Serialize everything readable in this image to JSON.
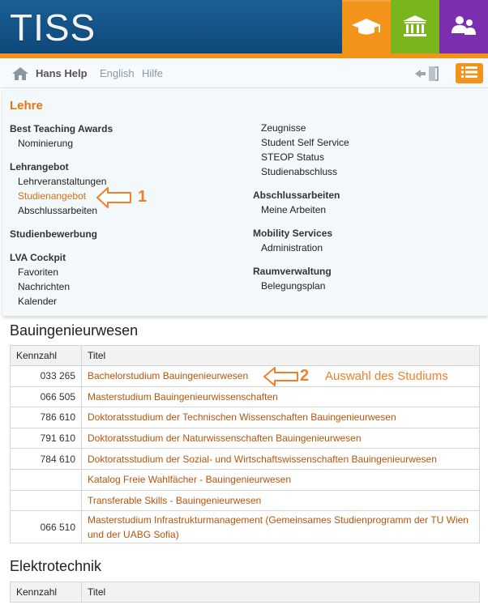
{
  "header": {
    "logo": "TISS",
    "tabs": [
      {
        "icon": "graduation-cap-icon",
        "color": "#f29419"
      },
      {
        "icon": "institution-icon",
        "color": "#7ab51d"
      },
      {
        "icon": "people-icon",
        "color": "#7b2fae"
      }
    ]
  },
  "toolbar": {
    "user": "Hans Help",
    "language": "English",
    "help": "Hilfe"
  },
  "menu": {
    "title": "Lehre",
    "left_groups": [
      {
        "heading": "Best Teaching Awards",
        "items": [
          "Nominierung"
        ]
      },
      {
        "heading": "Lehrangebot",
        "items": [
          "Lehrveranstaltungen",
          "Studienangebot",
          "Abschlussarbeiten"
        ]
      },
      {
        "heading": "Studienbewerbung",
        "items": []
      },
      {
        "heading": "LVA Cockpit",
        "items": [
          "Favoriten",
          "Nachrichten",
          "Kalender"
        ]
      }
    ],
    "right_top_items": [
      "Zeugnisse",
      "Student Self Service",
      "STEOP Status",
      "Studienabschluss"
    ],
    "right_groups": [
      {
        "heading": "Abschlussarbeiten",
        "items": [
          "Meine Arbeiten"
        ]
      },
      {
        "heading": "Mobility Services",
        "items": [
          "Administration"
        ]
      },
      {
        "heading": "Raumverwaltung",
        "items": [
          "Belegungsplan"
        ]
      }
    ]
  },
  "annotations": {
    "step1": "1",
    "step2": "2",
    "step2_text": "Auswahl des Studiums",
    "color": "#f07f28"
  },
  "sections": [
    {
      "title": "Bauingenieurwesen",
      "columns": [
        "Kennzahl",
        "Titel"
      ],
      "rows": [
        {
          "kennzahl": "033 265",
          "titel": "Bachelorstudium Bauingenieurwesen"
        },
        {
          "kennzahl": "066 505",
          "titel": "Masterstudium Bauingenieurwissenschaften"
        },
        {
          "kennzahl": "786 610",
          "titel": "Doktoratsstudium der Technischen Wissenschaften Bauingenieurwesen"
        },
        {
          "kennzahl": "791 610",
          "titel": "Doktoratsstudium der Naturwissenschaften Bauingenieurwesen"
        },
        {
          "kennzahl": "784 610",
          "titel": "Doktoratsstudium der Sozial- und Wirtschaftswissenschaften Bauingenieurwesen"
        },
        {
          "kennzahl": "",
          "titel": "Katalog Freie Wahlfächer - Bauingenieurwesen"
        },
        {
          "kennzahl": "",
          "titel": "Transferable Skills - Bauingenieurwesen"
        },
        {
          "kennzahl": "066 510",
          "titel": "Masterstudium Infrastrukturmanagement (Gemeinsames Studienprogramm der TU Wien und der UABG Sofia)"
        }
      ]
    },
    {
      "title": "Elektrotechnik",
      "columns": [
        "Kennzahl",
        "Titel"
      ],
      "rows": []
    }
  ],
  "colors": {
    "header_blue": "#0d4677",
    "accent_orange": "#f29419",
    "link": "#b8540b"
  }
}
